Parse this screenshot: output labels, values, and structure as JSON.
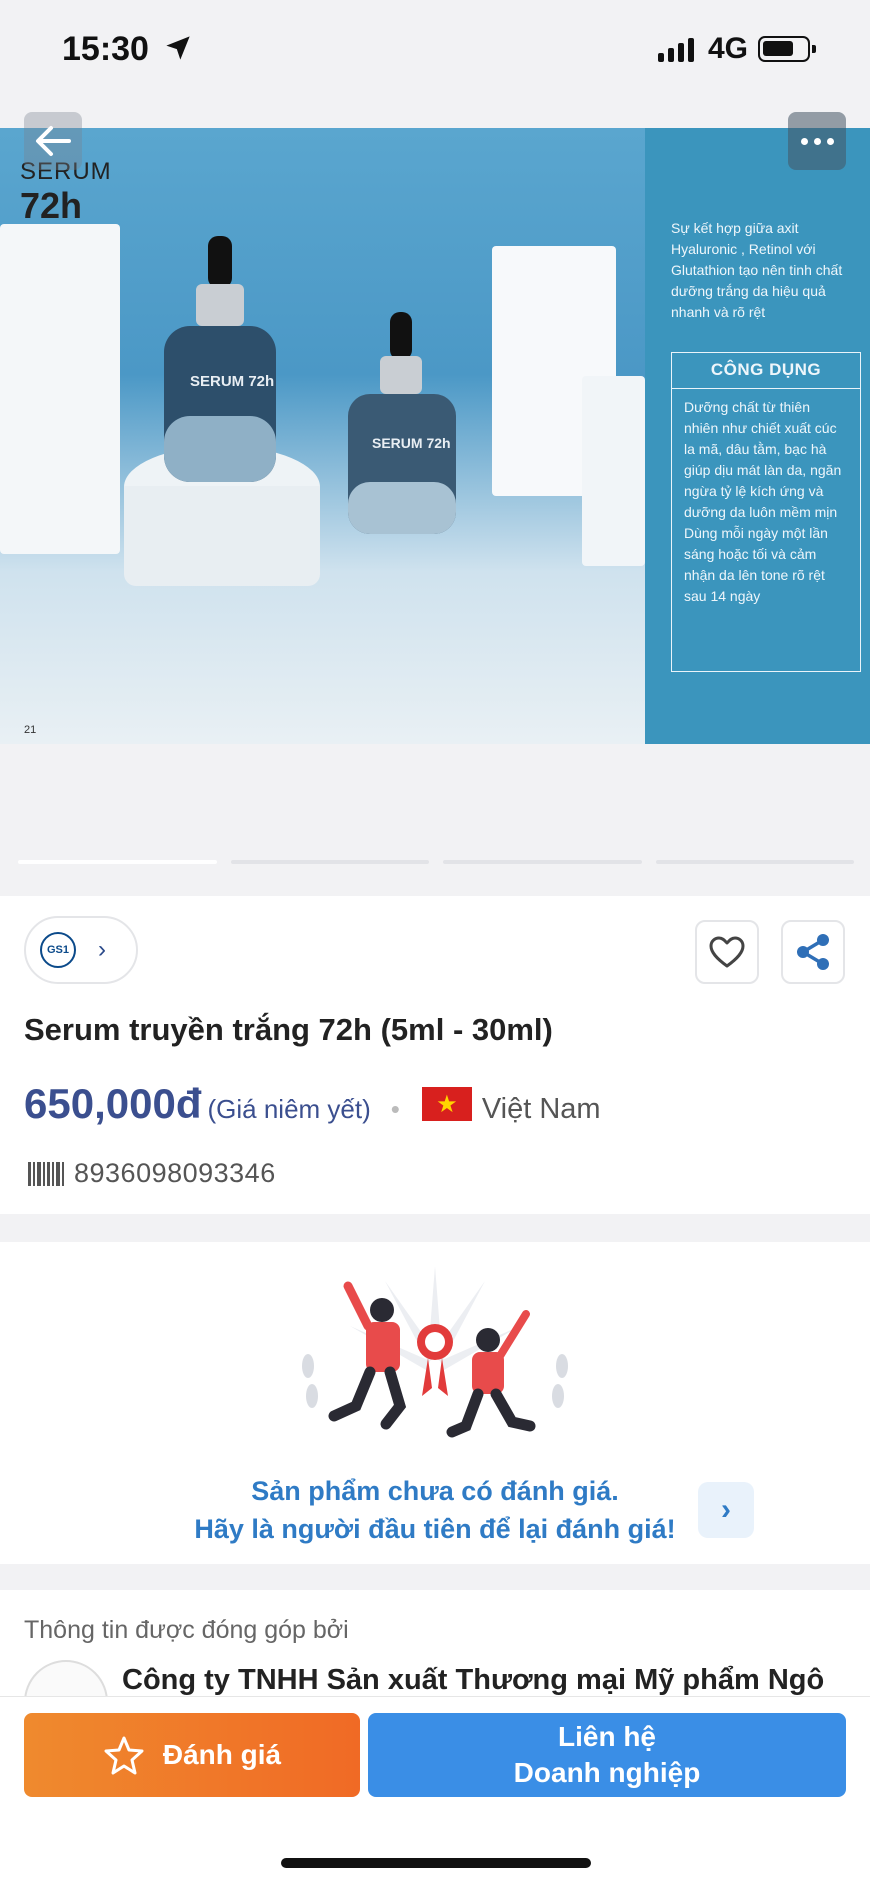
{
  "status_bar": {
    "time": "15:30",
    "network": "4G"
  },
  "hero": {
    "serum_label_1": "SERUM",
    "serum_label_2": "72h",
    "page_no": "21",
    "bottle_text": "SERUM 72h",
    "intro_text": "Sự kết hợp giữa axit Hyaluronic , Retinol với Glutathion tạo nên tinh chất dưỡng trắng da hiệu quả nhanh và rõ rệt",
    "cong_dung_title": "CÔNG DỤNG",
    "cong_dung_text": "Dưỡng chất từ thiên nhiên như chiết xuất cúc la mã, dâu tằm, bạc hà giúp dịu mát làn da, ngăn ngừa tỷ lệ kích ứng và dưỡng da luôn mềm mịn Dùng mỗi ngày một lần sáng hoặc tối và cảm nhận da lên tone rõ rệt sau 14 ngày"
  },
  "product": {
    "gs1_logo": "GS1",
    "title": "Serum truyền trắng 72h (5ml - 30ml)",
    "price": "650,000đ",
    "price_note": "(Giá niêm yết)",
    "country": "Việt Nam",
    "barcode": "8936098093346"
  },
  "rating": {
    "line1": "Sản phẩm chưa có đánh giá.",
    "line2": "Hãy là người đầu tiên để lại đánh giá!"
  },
  "contributor": {
    "label": "Thông tin được đóng góp bởi",
    "company": "Công ty TNHH Sản xuất Thương mại Mỹ phẩm Ngô"
  },
  "actions": {
    "rate_label": "Đánh giá",
    "contact_line1": "Liên hệ",
    "contact_line2": "Doanh nghiệp"
  },
  "colors": {
    "price": "#3b4f8f",
    "rating_text": "#2f7bc5",
    "rate_button": "#f06a25",
    "contact_button": "#3a8ee6"
  }
}
